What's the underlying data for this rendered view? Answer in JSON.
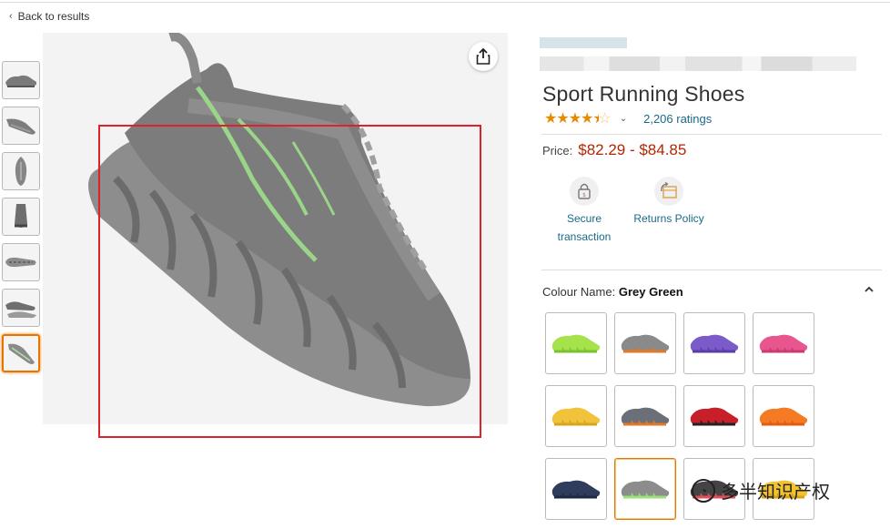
{
  "nav": {
    "back_label": "Back to results"
  },
  "product": {
    "title": "Sport Running Shoes",
    "rating_stars": 4.5,
    "ratings_count": "2,206 ratings",
    "price_label": "Price:",
    "price_value": "$82.29 - $84.85"
  },
  "features": [
    {
      "label_line1": "Secure",
      "label_line2": "transaction",
      "icon": "lock-icon"
    },
    {
      "label_line1": "Returns Policy",
      "label_line2": "",
      "icon": "returns-box-icon"
    }
  ],
  "colour": {
    "label": "Colour Name:",
    "selected": "Grey Green"
  },
  "swatches": [
    {
      "color": "#a6e34a",
      "accent": "#7bc230"
    },
    {
      "color": "#8a8a8a",
      "accent": "#e07a2a"
    },
    {
      "color": "#7b5bc9",
      "accent": "#5a3ea8"
    },
    {
      "color": "#e8558f",
      "accent": "#c83c72"
    },
    {
      "color": "#f0c33a",
      "accent": "#d9a520"
    },
    {
      "color": "#6a6f78",
      "accent": "#e07a2a"
    },
    {
      "color": "#c8202a",
      "accent": "#222222"
    },
    {
      "color": "#f57a24",
      "accent": "#e05e10"
    },
    {
      "color": "#2f3c5c",
      "accent": "#1e2a44"
    },
    {
      "color": "#8c8c8c",
      "accent": "#9be07a"
    },
    {
      "color": "#444444",
      "accent": "#e0505a"
    },
    {
      "color": "#f2c230",
      "accent": "#d6a218"
    }
  ],
  "selected_swatch_index": 9,
  "selected_thumb_index": 6,
  "watermark": {
    "text": "多半知识产权"
  },
  "colors": {
    "accent": "#e77600",
    "price": "#b12704",
    "link": "#1a6a8a",
    "star": "#e68a00",
    "highlight_box": "#e0202a"
  }
}
